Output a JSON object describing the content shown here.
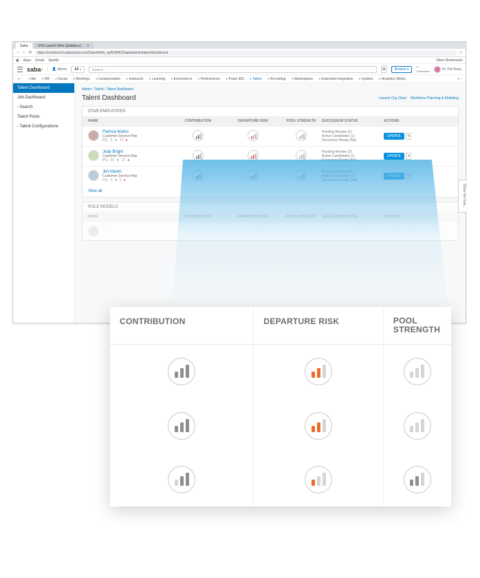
{
  "browser": {
    "tabs": [
      {
        "label": "Saba"
      },
      {
        "label": "U43 Launch Web Updates.d..."
      }
    ],
    "url": "https://onedemo3.sabacloud.com/Saba/Web_spf/DEMO3/app/admin/talent/dashboard",
    "bookmarks_label": "Apps",
    "bookmarks": [
      "Gmail",
      "Spotify"
    ],
    "other_bookmarks": "Other Bookmarks"
  },
  "header": {
    "logo": "saba",
    "admin": "Admin",
    "search_scope": "All",
    "search_placeholder": "Search...",
    "browse": "Browse",
    "collections": "Collections",
    "greeting": "Hi, Pat Rose"
  },
  "nav": [
    "Me",
    "HR",
    "Social",
    "Meetings",
    "Compensation",
    "Instructor",
    "Learning",
    "Ecommerce",
    "Performance",
    "Pulse 360",
    "Talent",
    "Recruiting",
    "Marketplace",
    "Extended Integration",
    "System",
    "Analytics (Beta)"
  ],
  "nav_active_index": 10,
  "sidebar": {
    "items": [
      {
        "label": "Talent Dashboard",
        "active": true
      },
      {
        "label": "Job Dashboard"
      },
      {
        "label": "Search",
        "caret": true
      },
      {
        "label": "Talent Pools"
      },
      {
        "label": "Talent Configurations",
        "caret": true
      }
    ]
  },
  "breadcrumb": [
    "Admin",
    "Talent",
    "Talent Dashboard"
  ],
  "page": {
    "title": "Talent Dashboard",
    "links": [
      "Launch Org Chart",
      "Workforce Planning & Modeling"
    ]
  },
  "panel1": {
    "title": "STAR EMPLOYEES",
    "columns": [
      "NAME",
      "CONTRIBUTION",
      "DEPARTURE RISK",
      "POOL STRENGTH",
      "SUCCESSOR STATUS",
      "ACTIONS"
    ],
    "rows": [
      {
        "name": "Patricia Marks",
        "role": "Customer Service Rep",
        "pq": "PQ - 2",
        "rating": "17",
        "status": [
          "Pending Review (2)",
          "Active Candidates (1)",
          "Successor Ready (No)"
        ],
        "action": "UPDATE"
      },
      {
        "name": "Judy Bright",
        "role": "Customer Service Rep",
        "pq": "PQ - 20",
        "rating": "17",
        "status": [
          "Pending Review (3)",
          "Active Candidates (1)",
          "Successor Ready (No)"
        ],
        "action": "UPDATE"
      },
      {
        "name": "Jim Martin",
        "role": "Customer Service Rep",
        "pq": "PQ - 0",
        "rating": "6",
        "status": [
          "Pending Review (3)",
          "Active Candidates (1)",
          "Successor Ready (Yes)"
        ],
        "action": "UPDATE"
      }
    ],
    "view_all": "View all"
  },
  "panel2": {
    "title": "ROLE MODELS",
    "columns": [
      "NAME",
      "CONTRIBUTION",
      "DEPARTURE RISK",
      "POOL STRENGTH",
      "SUCCESSOR STATUS",
      "ACTIONS"
    ]
  },
  "side_tab": "Show me how...",
  "zoom": {
    "headers": [
      "CONTRIBUTION",
      "DEPARTURE RISK",
      "POOL STRENGTH"
    ],
    "rows": [
      {
        "contribution": "med-high",
        "risk": "orange-low",
        "strength": "low"
      },
      {
        "contribution": "rising",
        "risk": "orange-med",
        "strength": "low-alt"
      },
      {
        "contribution": "mixed",
        "risk": "orange-one",
        "strength": "rising-grey"
      }
    ]
  }
}
